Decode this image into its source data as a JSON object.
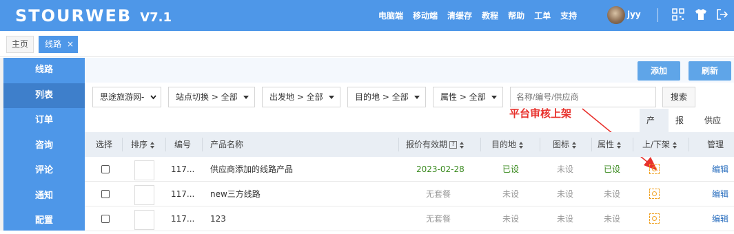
{
  "header": {
    "logo": "STOURWEB",
    "version": "V7.1",
    "nav": [
      "电脑端",
      "移动端",
      "清缓存",
      "教程",
      "帮助",
      "工单",
      "支持"
    ],
    "username": "jyy",
    "icons": [
      "qrcode-icon",
      "shirt-icon",
      "logout-icon"
    ]
  },
  "tabs": {
    "home": "主页",
    "active": "线路",
    "close": "×"
  },
  "sidebar": {
    "items": [
      "线路",
      "列表",
      "订单",
      "咨询",
      "评论",
      "通知",
      "配置"
    ],
    "active_index": 1
  },
  "toolbar": {
    "add": "添加",
    "refresh": "刷新"
  },
  "filters": {
    "site": "思途旅游网-",
    "station": "站点切换 > 全部",
    "departure": "出发地 > 全部",
    "destination": "目的地 > 全部",
    "attribute": "属性 > 全部",
    "search_placeholder": "名称/编号/供应商",
    "search_button": "搜索"
  },
  "annotation": "平台审核上架",
  "subtabs": [
    "产品",
    "报价",
    "供应商"
  ],
  "table": {
    "columns": [
      "选择",
      "排序",
      "编号",
      "产品名称",
      "报价有效期",
      "目的地",
      "图标",
      "属性",
      "上/下架",
      "管理"
    ],
    "rows": [
      {
        "id": "117...",
        "name": "供应商添加的线路产品",
        "validity": "2023-02-28",
        "destination": "已设",
        "icon": "未设",
        "attribute": "已设",
        "action": "编辑"
      },
      {
        "id": "117...",
        "name": "new三方线路",
        "validity": "无套餐",
        "destination": "未设",
        "icon": "未设",
        "attribute": "未设",
        "action": "编辑"
      },
      {
        "id": "117...",
        "name": "123",
        "validity": "无套餐",
        "destination": "未设",
        "icon": "未设",
        "attribute": "未设",
        "action": "编辑"
      }
    ]
  },
  "colors": {
    "primary": "#4e97e8",
    "annotation": "#e8312c",
    "status_set": "#3a8a1f",
    "status_unset": "#999999",
    "link": "#2b6fbf"
  }
}
